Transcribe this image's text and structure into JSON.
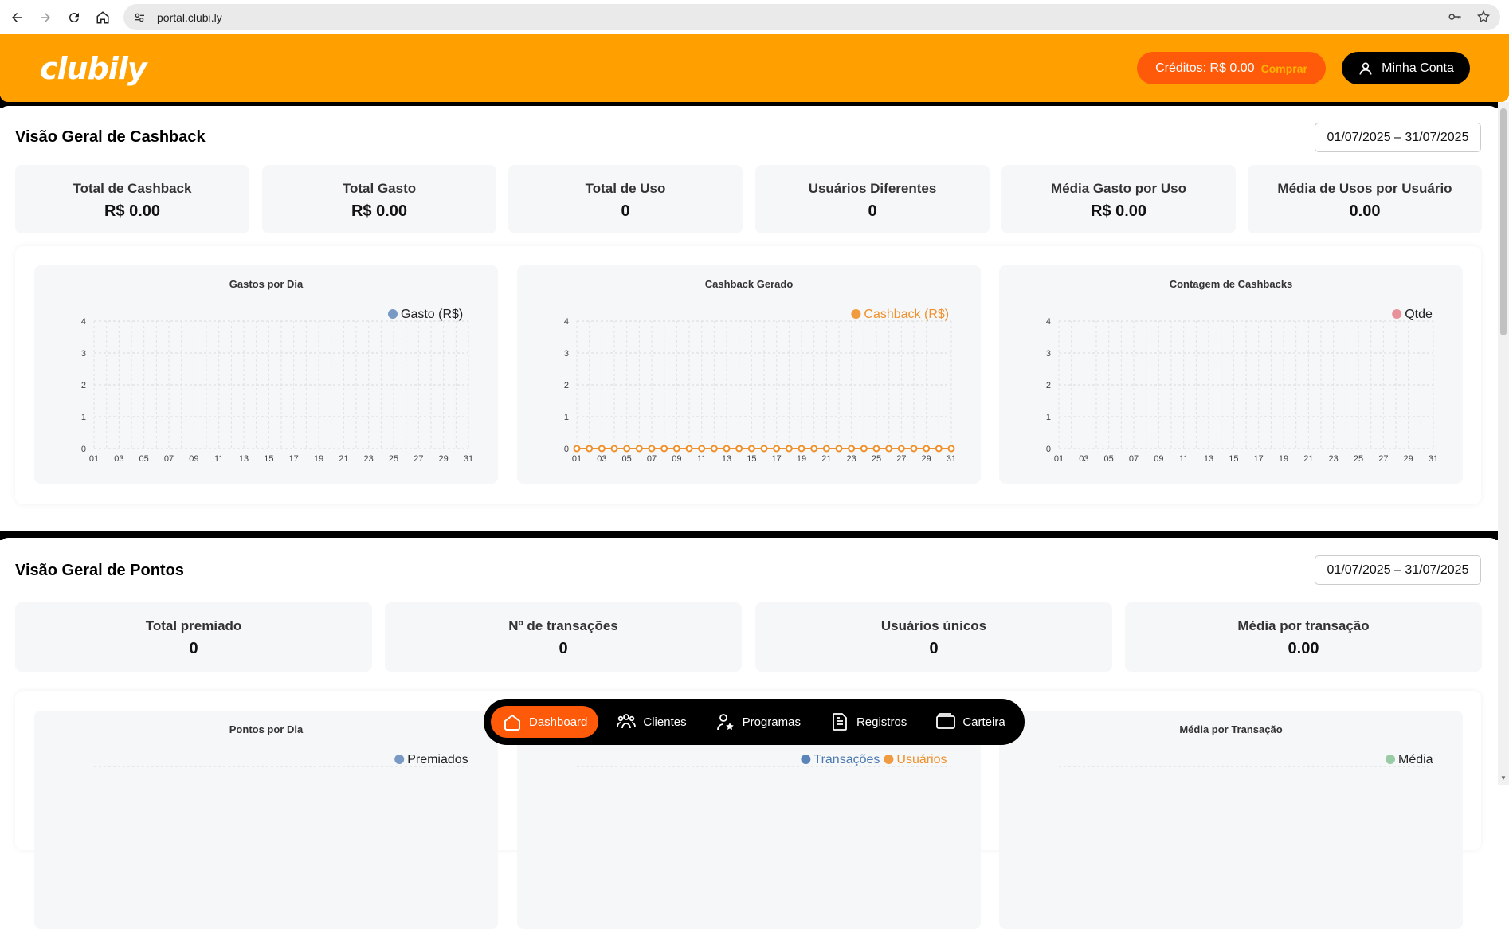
{
  "browser": {
    "url": "portal.clubi.ly"
  },
  "header": {
    "logo": "clubily",
    "credits_label": "Créditos: R$ 0.00",
    "buy_label": "Comprar",
    "account_label": "Minha Conta"
  },
  "cashback": {
    "title": "Visão Geral de Cashback",
    "date_range": "01/07/2025 – 31/07/2025",
    "stats": [
      {
        "label": "Total de Cashback",
        "value": "R$ 0.00"
      },
      {
        "label": "Total Gasto",
        "value": "R$ 0.00"
      },
      {
        "label": "Total de Uso",
        "value": "0"
      },
      {
        "label": "Usuários Diferentes",
        "value": "0"
      },
      {
        "label": "Média Gasto por Uso",
        "value": "R$ 0.00"
      },
      {
        "label": "Média de Usos por Usuário",
        "value": "0.00"
      }
    ]
  },
  "pontos": {
    "title": "Visão Geral de Pontos",
    "date_range": "01/07/2025 – 31/07/2025",
    "stats": [
      {
        "label": "Total premiado",
        "value": "0"
      },
      {
        "label": "Nº de transações",
        "value": "0"
      },
      {
        "label": "Usuários únicos",
        "value": "0"
      },
      {
        "label": "Média por transação",
        "value": "0.00"
      }
    ]
  },
  "chart_data": [
    {
      "type": "line",
      "title": "Gastos por Dia",
      "x": [
        "01",
        "03",
        "05",
        "07",
        "09",
        "11",
        "13",
        "15",
        "17",
        "19",
        "21",
        "23",
        "25",
        "27",
        "29",
        "31"
      ],
      "ylim": [
        0,
        4
      ],
      "yticks": [
        "0",
        "1",
        "2",
        "3",
        "4"
      ],
      "series": [
        {
          "name": "Gasto (R$)",
          "color": "#6c8ebf",
          "values": []
        }
      ],
      "legend": "top-right",
      "grid": true
    },
    {
      "type": "line",
      "title": "Cashback Gerado",
      "x": [
        "01",
        "03",
        "05",
        "07",
        "09",
        "11",
        "13",
        "15",
        "17",
        "19",
        "21",
        "23",
        "25",
        "27",
        "29",
        "31"
      ],
      "ylim": [
        0,
        4
      ],
      "yticks": [
        "0",
        "1",
        "2",
        "3",
        "4"
      ],
      "series": [
        {
          "name": "Cashback (R$)",
          "color": "#f0902a",
          "values": [
            0,
            0,
            0,
            0,
            0,
            0,
            0,
            0,
            0,
            0,
            0,
            0,
            0,
            0,
            0,
            0,
            0,
            0,
            0,
            0,
            0,
            0,
            0,
            0,
            0,
            0,
            0,
            0,
            0,
            0,
            0
          ]
        }
      ],
      "legend": "top-right",
      "grid": true
    },
    {
      "type": "line",
      "title": "Contagem de Cashbacks",
      "x": [
        "01",
        "03",
        "05",
        "07",
        "09",
        "11",
        "13",
        "15",
        "17",
        "19",
        "21",
        "23",
        "25",
        "27",
        "29",
        "31"
      ],
      "ylim": [
        0,
        4
      ],
      "yticks": [
        "0",
        "1",
        "2",
        "3",
        "4"
      ],
      "series": [
        {
          "name": "Qtde",
          "color": "#e8858f",
          "values": []
        }
      ],
      "legend": "top-right",
      "grid": true
    },
    {
      "type": "line",
      "title": "Pontos por Dia",
      "series": [
        {
          "name": "Premiados",
          "color": "#6c8ebf",
          "values": []
        }
      ],
      "legend": "top-right"
    },
    {
      "type": "line",
      "title": "",
      "series": [
        {
          "name": "Transações",
          "color": "#4a78b0",
          "values": []
        },
        {
          "name": "Usuários",
          "color": "#f0902a",
          "values": []
        }
      ],
      "legend": "top-right"
    },
    {
      "type": "line",
      "title": "Média por Transação",
      "series": [
        {
          "name": "Média",
          "color": "#8fc79a",
          "values": []
        }
      ],
      "legend": "top-right"
    }
  ],
  "bottom_nav": {
    "items": [
      {
        "label": "Dashboard",
        "icon": "home-icon",
        "active": true
      },
      {
        "label": "Clientes",
        "icon": "users-icon"
      },
      {
        "label": "Programas",
        "icon": "user-star-icon"
      },
      {
        "label": "Registros",
        "icon": "document-icon"
      },
      {
        "label": "Carteira",
        "icon": "wallet-icon"
      }
    ]
  },
  "colors": {
    "header": "#ffa000",
    "accent": "#ff5a0a",
    "card_bg": "#f6f7f9"
  }
}
